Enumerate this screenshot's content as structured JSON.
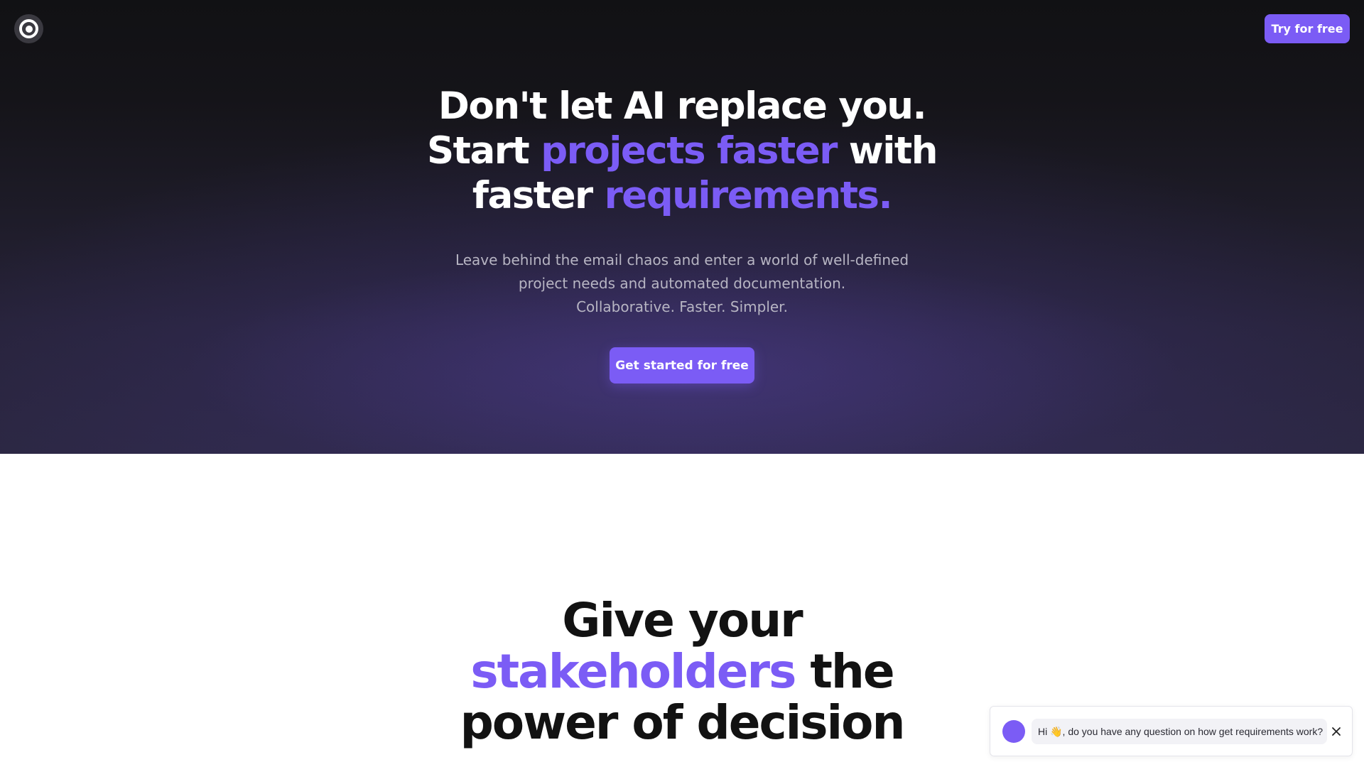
{
  "header": {
    "logo_icon": "target-ring-icon",
    "try_button_label": "Try for free"
  },
  "hero": {
    "headline_line1": "Don't let AI replace you.",
    "headline_line2_pre": "Start ",
    "headline_line2_accent": "projects faster",
    "headline_line2_post": " with",
    "headline_line3_pre": "faster ",
    "headline_line3_accent": "requirements.",
    "subtext_line1": "Leave behind the email chaos and enter a world of well-defined",
    "subtext_line2": "project needs and automated documentation.",
    "subtext_line3": "Collaborative. Faster. Simpler.",
    "cta_label": "Get started for free"
  },
  "section2": {
    "title_line1": "Give your",
    "title_line2_accent": "stakeholders",
    "title_line2_post": " the",
    "title_line3": "power of decision"
  },
  "chat": {
    "message": "Hi 👋, do you have any question on how get requirements work?",
    "close_icon": "close-icon"
  },
  "colors": {
    "accent": "#7b5cf5",
    "hero_background": "#151419",
    "text_dark": "#121212"
  }
}
